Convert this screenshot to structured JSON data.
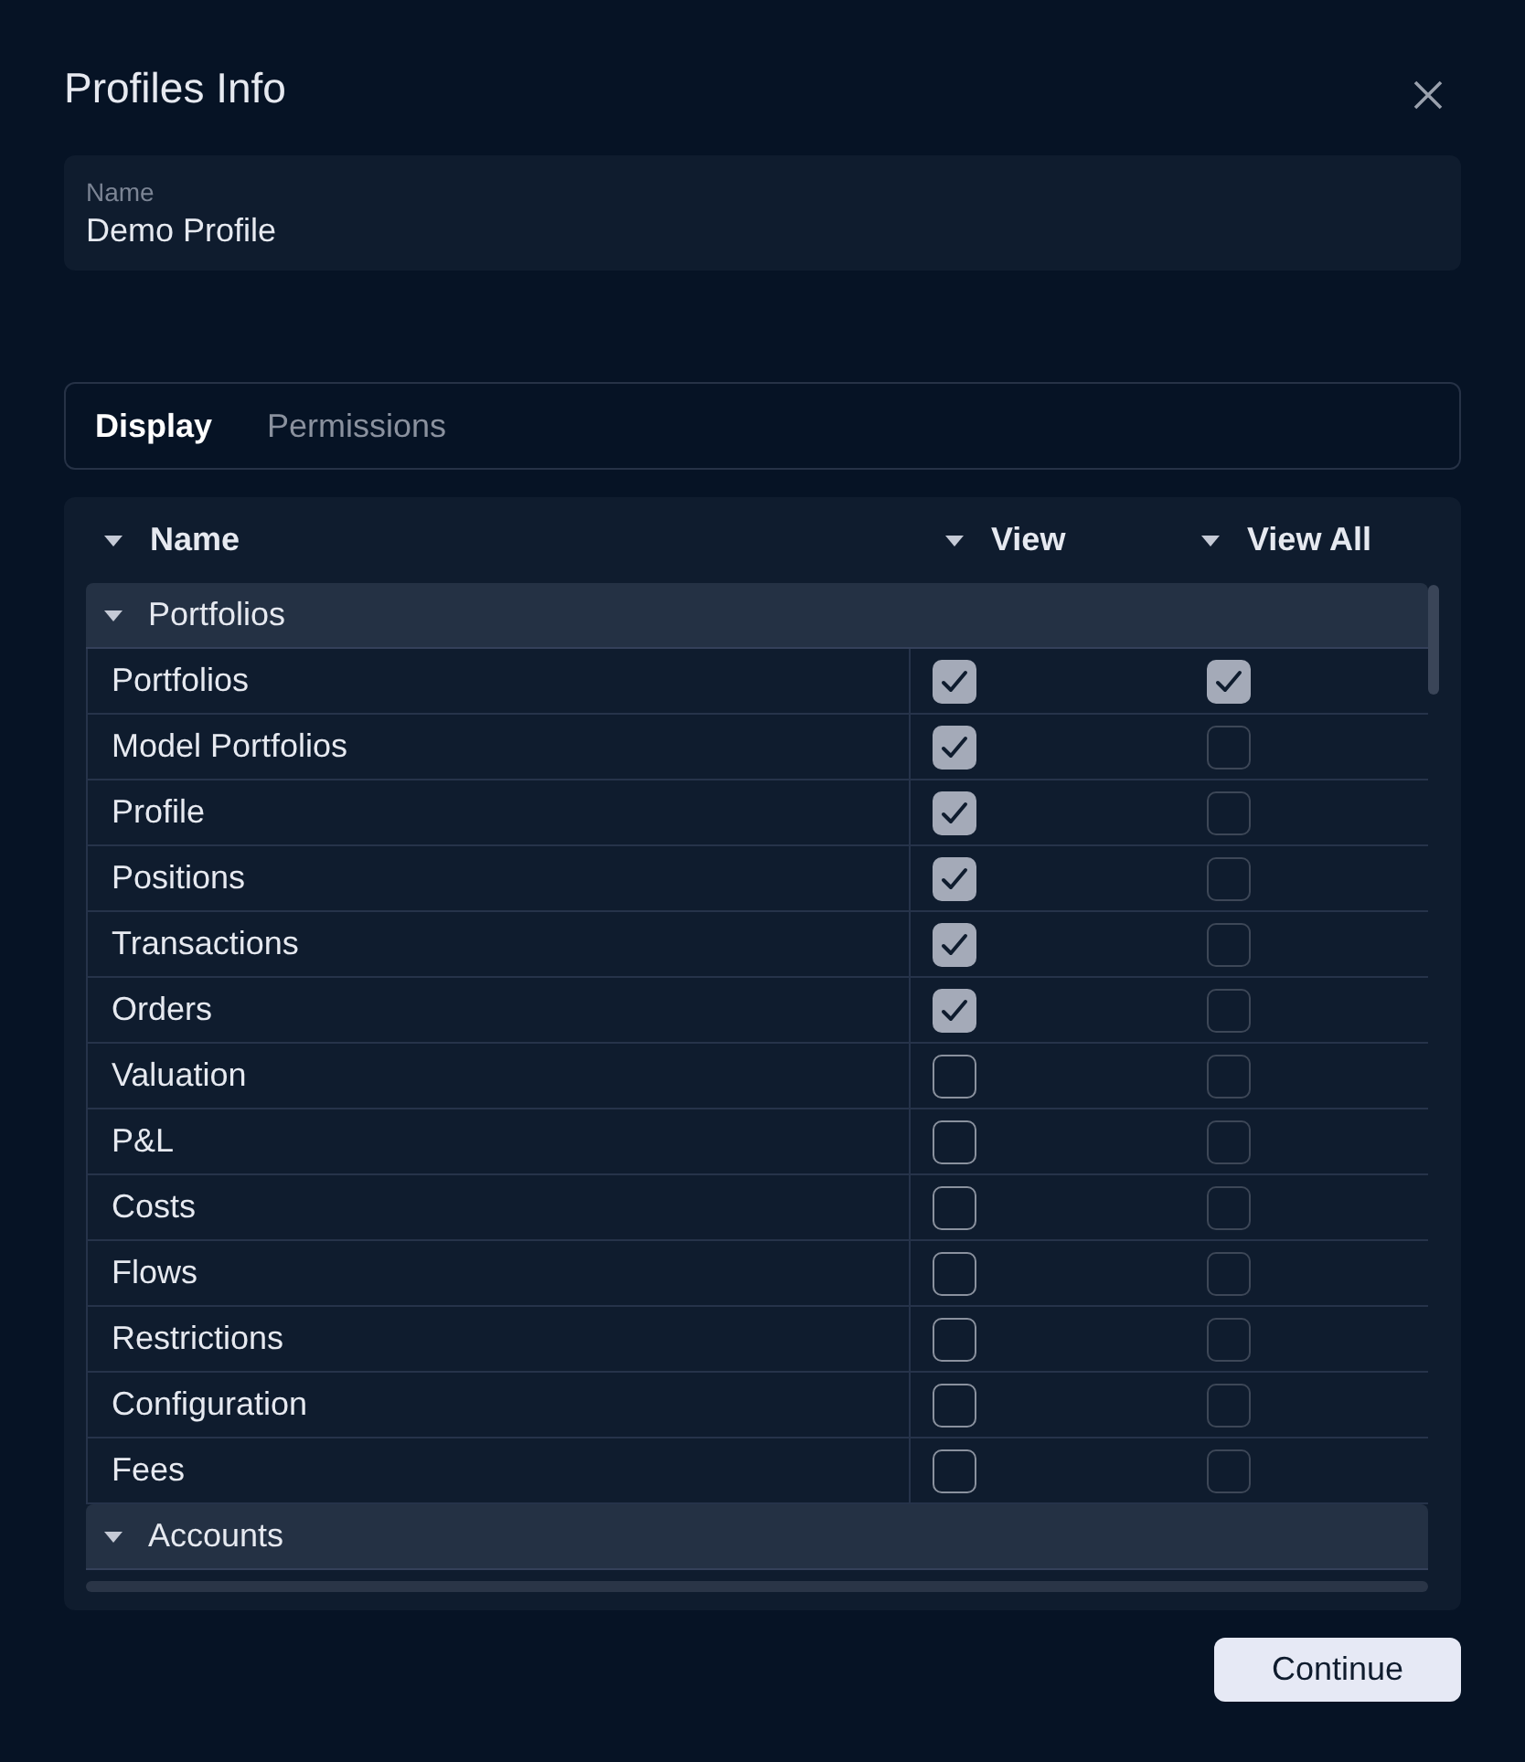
{
  "dialog": {
    "title": "Profiles Info"
  },
  "name_field": {
    "label": "Name",
    "value": "Demo Profile"
  },
  "tabs": [
    {
      "label": "Display",
      "selected": true
    },
    {
      "label": "Permissions",
      "selected": false
    }
  ],
  "table": {
    "columns": [
      "Name",
      "View",
      "View All"
    ],
    "groups": [
      {
        "label": "Portfolios",
        "expanded": true,
        "rows": [
          {
            "name": "Portfolios",
            "view": true,
            "view_all": true
          },
          {
            "name": "Model Portfolios",
            "view": true,
            "view_all": false
          },
          {
            "name": "Profile",
            "view": true,
            "view_all": false
          },
          {
            "name": "Positions",
            "view": true,
            "view_all": false
          },
          {
            "name": "Transactions",
            "view": true,
            "view_all": false
          },
          {
            "name": "Orders",
            "view": true,
            "view_all": false
          },
          {
            "name": "Valuation",
            "view": false,
            "view_all": false
          },
          {
            "name": "P&L",
            "view": false,
            "view_all": false
          },
          {
            "name": "Costs",
            "view": false,
            "view_all": false
          },
          {
            "name": "Flows",
            "view": false,
            "view_all": false
          },
          {
            "name": "Restrictions",
            "view": false,
            "view_all": false
          },
          {
            "name": "Configuration",
            "view": false,
            "view_all": false
          },
          {
            "name": "Fees",
            "view": false,
            "view_all": false
          }
        ]
      },
      {
        "label": "Accounts",
        "expanded": true
      }
    ]
  },
  "buttons": [
    {
      "label": "Continue"
    }
  ]
}
